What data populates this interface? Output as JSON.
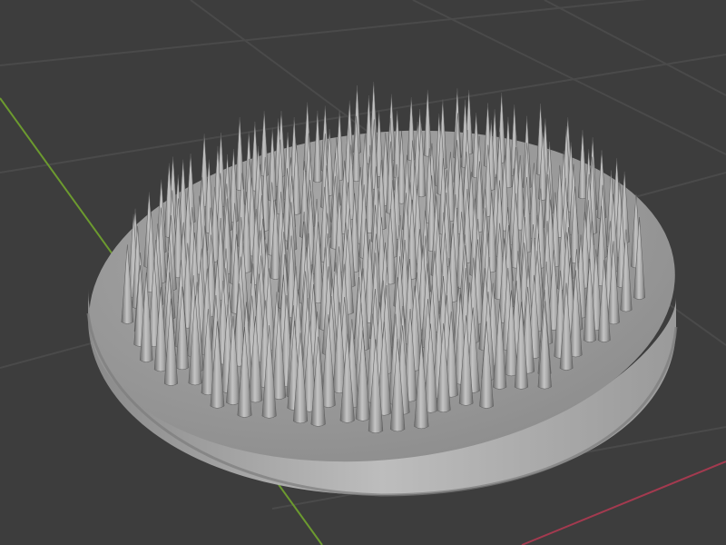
{
  "viewport": {
    "background_color": "#3d3d3d",
    "grid_line_color": "#4a4a4a",
    "axis_y_color": "#6c9a2f",
    "axis_x_color": "#a33a4f"
  },
  "object": {
    "name": "spiked disc",
    "base_color": "#9c9c9c",
    "spike_color": "#a6a6a6"
  }
}
